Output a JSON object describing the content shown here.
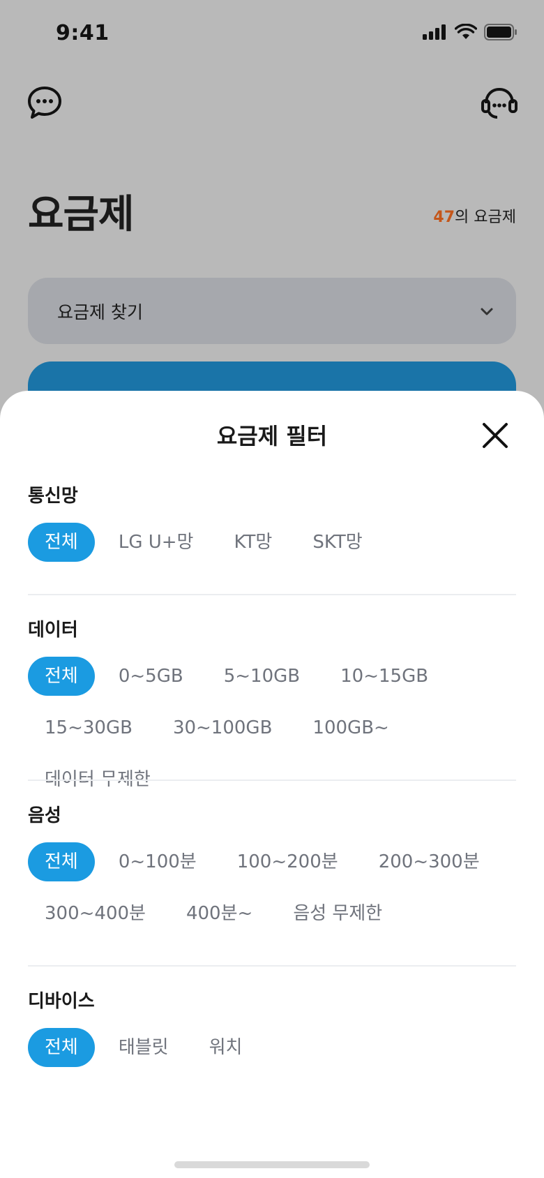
{
  "status_bar": {
    "time": "9:41"
  },
  "header": {
    "left_icon": "chat-bubble-icon",
    "right_icon": "headset-support-icon",
    "title": "요금제",
    "count_number": "47",
    "count_suffix": "의 요금제"
  },
  "search": {
    "label": "요금제 찾기"
  },
  "sheet": {
    "title": "요금제 필터",
    "sections": [
      {
        "title": "통신망",
        "chips": [
          "전체",
          "LG U+망",
          "KT망",
          "SKT망"
        ]
      },
      {
        "title": "데이터",
        "chips": [
          "전체",
          "0~5GB",
          "5~10GB",
          "10~15GB",
          "15~30GB",
          "30~100GB",
          "100GB~",
          "데이터 무제한"
        ]
      },
      {
        "title": "음성",
        "chips": [
          "전체",
          "0~100분",
          "100~200분",
          "200~300분",
          "300~400분",
          "400분~",
          "음성 무제한"
        ]
      },
      {
        "title": "디바이스",
        "chips": [
          "전체",
          "태블릿",
          "워치"
        ]
      }
    ]
  },
  "colors": {
    "accent": "#1b9be1",
    "count_accent": "#c4561a",
    "overlay": "#b9b9b9"
  }
}
